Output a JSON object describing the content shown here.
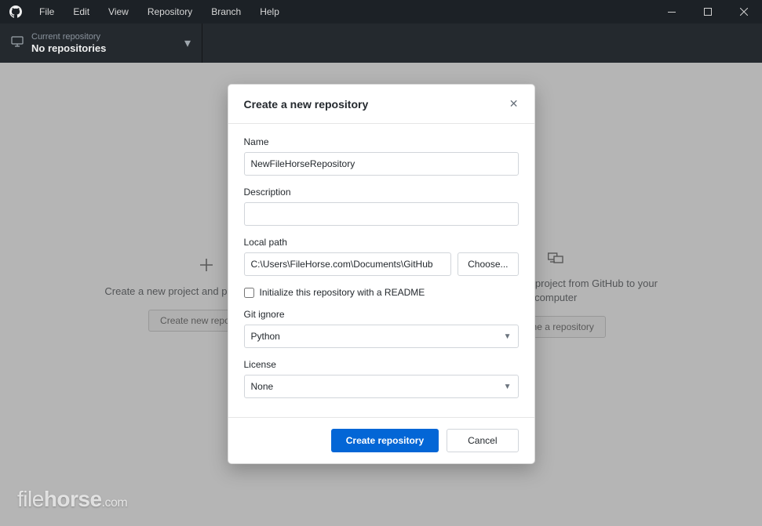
{
  "menu": {
    "items": [
      "File",
      "Edit",
      "View",
      "Repository",
      "Branch",
      "Help"
    ]
  },
  "toolbar": {
    "repo_label": "Current repository",
    "repo_value": "No repositories"
  },
  "options": {
    "create": {
      "text": "Create a new project and publish it to GitHub",
      "button": "Create new repository"
    },
    "clone": {
      "text": "Clone an existing project from GitHub to your computer",
      "button": "Clone a repository"
    }
  },
  "modal": {
    "title": "Create a new repository",
    "name_label": "Name",
    "name_value": "NewFileHorseRepository",
    "desc_label": "Description",
    "desc_value": "",
    "path_label": "Local path",
    "path_value": "C:\\Users\\FileHorse.com\\Documents\\GitHub",
    "choose_label": "Choose...",
    "readme_label": "Initialize this repository with a README",
    "gitignore_label": "Git ignore",
    "gitignore_value": "Python",
    "license_label": "License",
    "license_value": "None",
    "submit": "Create repository",
    "cancel": "Cancel"
  },
  "watermark": {
    "a": "file",
    "b": "horse",
    "c": ".com"
  }
}
